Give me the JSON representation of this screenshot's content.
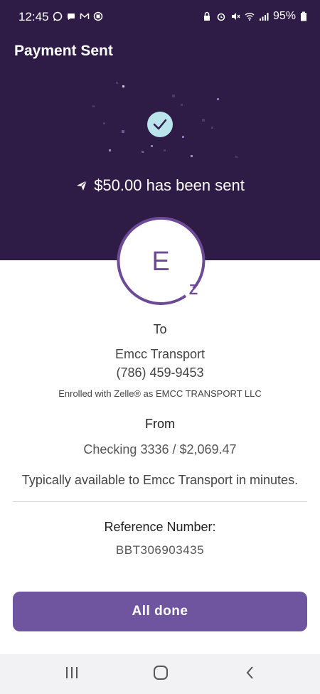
{
  "status_bar": {
    "time": "12:45",
    "battery": "95%",
    "left_icons": [
      "whatsapp-icon",
      "chat-icon",
      "gmail-icon",
      "app-icon"
    ],
    "right_icons": [
      "lock-icon",
      "alarm-icon",
      "mute-icon",
      "wifi-icon",
      "signal-icon",
      "battery-icon"
    ]
  },
  "header": {
    "title": "Payment Sent"
  },
  "confirmation": {
    "amount_message": "$50.00 has been sent",
    "check_icon": "check-circle-icon",
    "send_icon": "paper-plane-icon"
  },
  "recipient": {
    "avatar_letter": "E",
    "badge": "Z",
    "to_label": "To",
    "name": "Emcc Transport",
    "phone": "(786) 459-9453",
    "enrolled": "Enrolled with Zelle® as EMCC TRANSPORT LLC"
  },
  "source": {
    "from_label": "From",
    "account": "Checking 3336 / $2,069.47",
    "availability": "Typically available to Emcc Transport in minutes."
  },
  "reference": {
    "label": "Reference Number:",
    "value": "BBT306903435"
  },
  "actions": {
    "done_label": "All done"
  },
  "colors": {
    "header_bg": "#2e1b46",
    "accent": "#6f55a0",
    "check_bg": "#b9e4ec"
  },
  "nav": {
    "icons": [
      "recent-apps-icon",
      "home-icon",
      "back-icon"
    ]
  }
}
